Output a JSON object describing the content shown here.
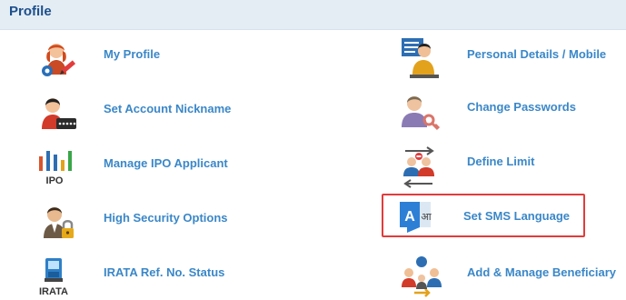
{
  "header": {
    "title": "Profile"
  },
  "left_items": [
    {
      "label": "My Profile",
      "icon": "user-edit-icon"
    },
    {
      "label": "Set Account Nickname",
      "icon": "user-card-icon"
    },
    {
      "label": "Manage IPO Applicant",
      "icon": "ipo-chart-icon",
      "icon_text": "IPO"
    },
    {
      "label": "High Security Options",
      "icon": "user-lock-icon"
    },
    {
      "label": "IRATA Ref. No. Status",
      "icon": "irata-machine-icon",
      "icon_text": "IRATA"
    }
  ],
  "right_items": [
    {
      "label": "Personal Details / Mobile",
      "icon": "presenter-icon"
    },
    {
      "label": "Change Passwords",
      "icon": "user-key-icon"
    },
    {
      "label": "Define Limit",
      "icon": "users-limit-icon"
    },
    {
      "label": "Set SMS Language",
      "icon": "language-icon",
      "icon_text_a": "A",
      "icon_text_b": "आ",
      "highlighted": true
    },
    {
      "label": "Add & Manage Beneficiary",
      "icon": "beneficiary-icon"
    }
  ],
  "colors": {
    "header_bg": "#e4edf4",
    "title": "#1d4f8c",
    "link": "#3a87c8",
    "highlight_border": "#e03c3c"
  }
}
